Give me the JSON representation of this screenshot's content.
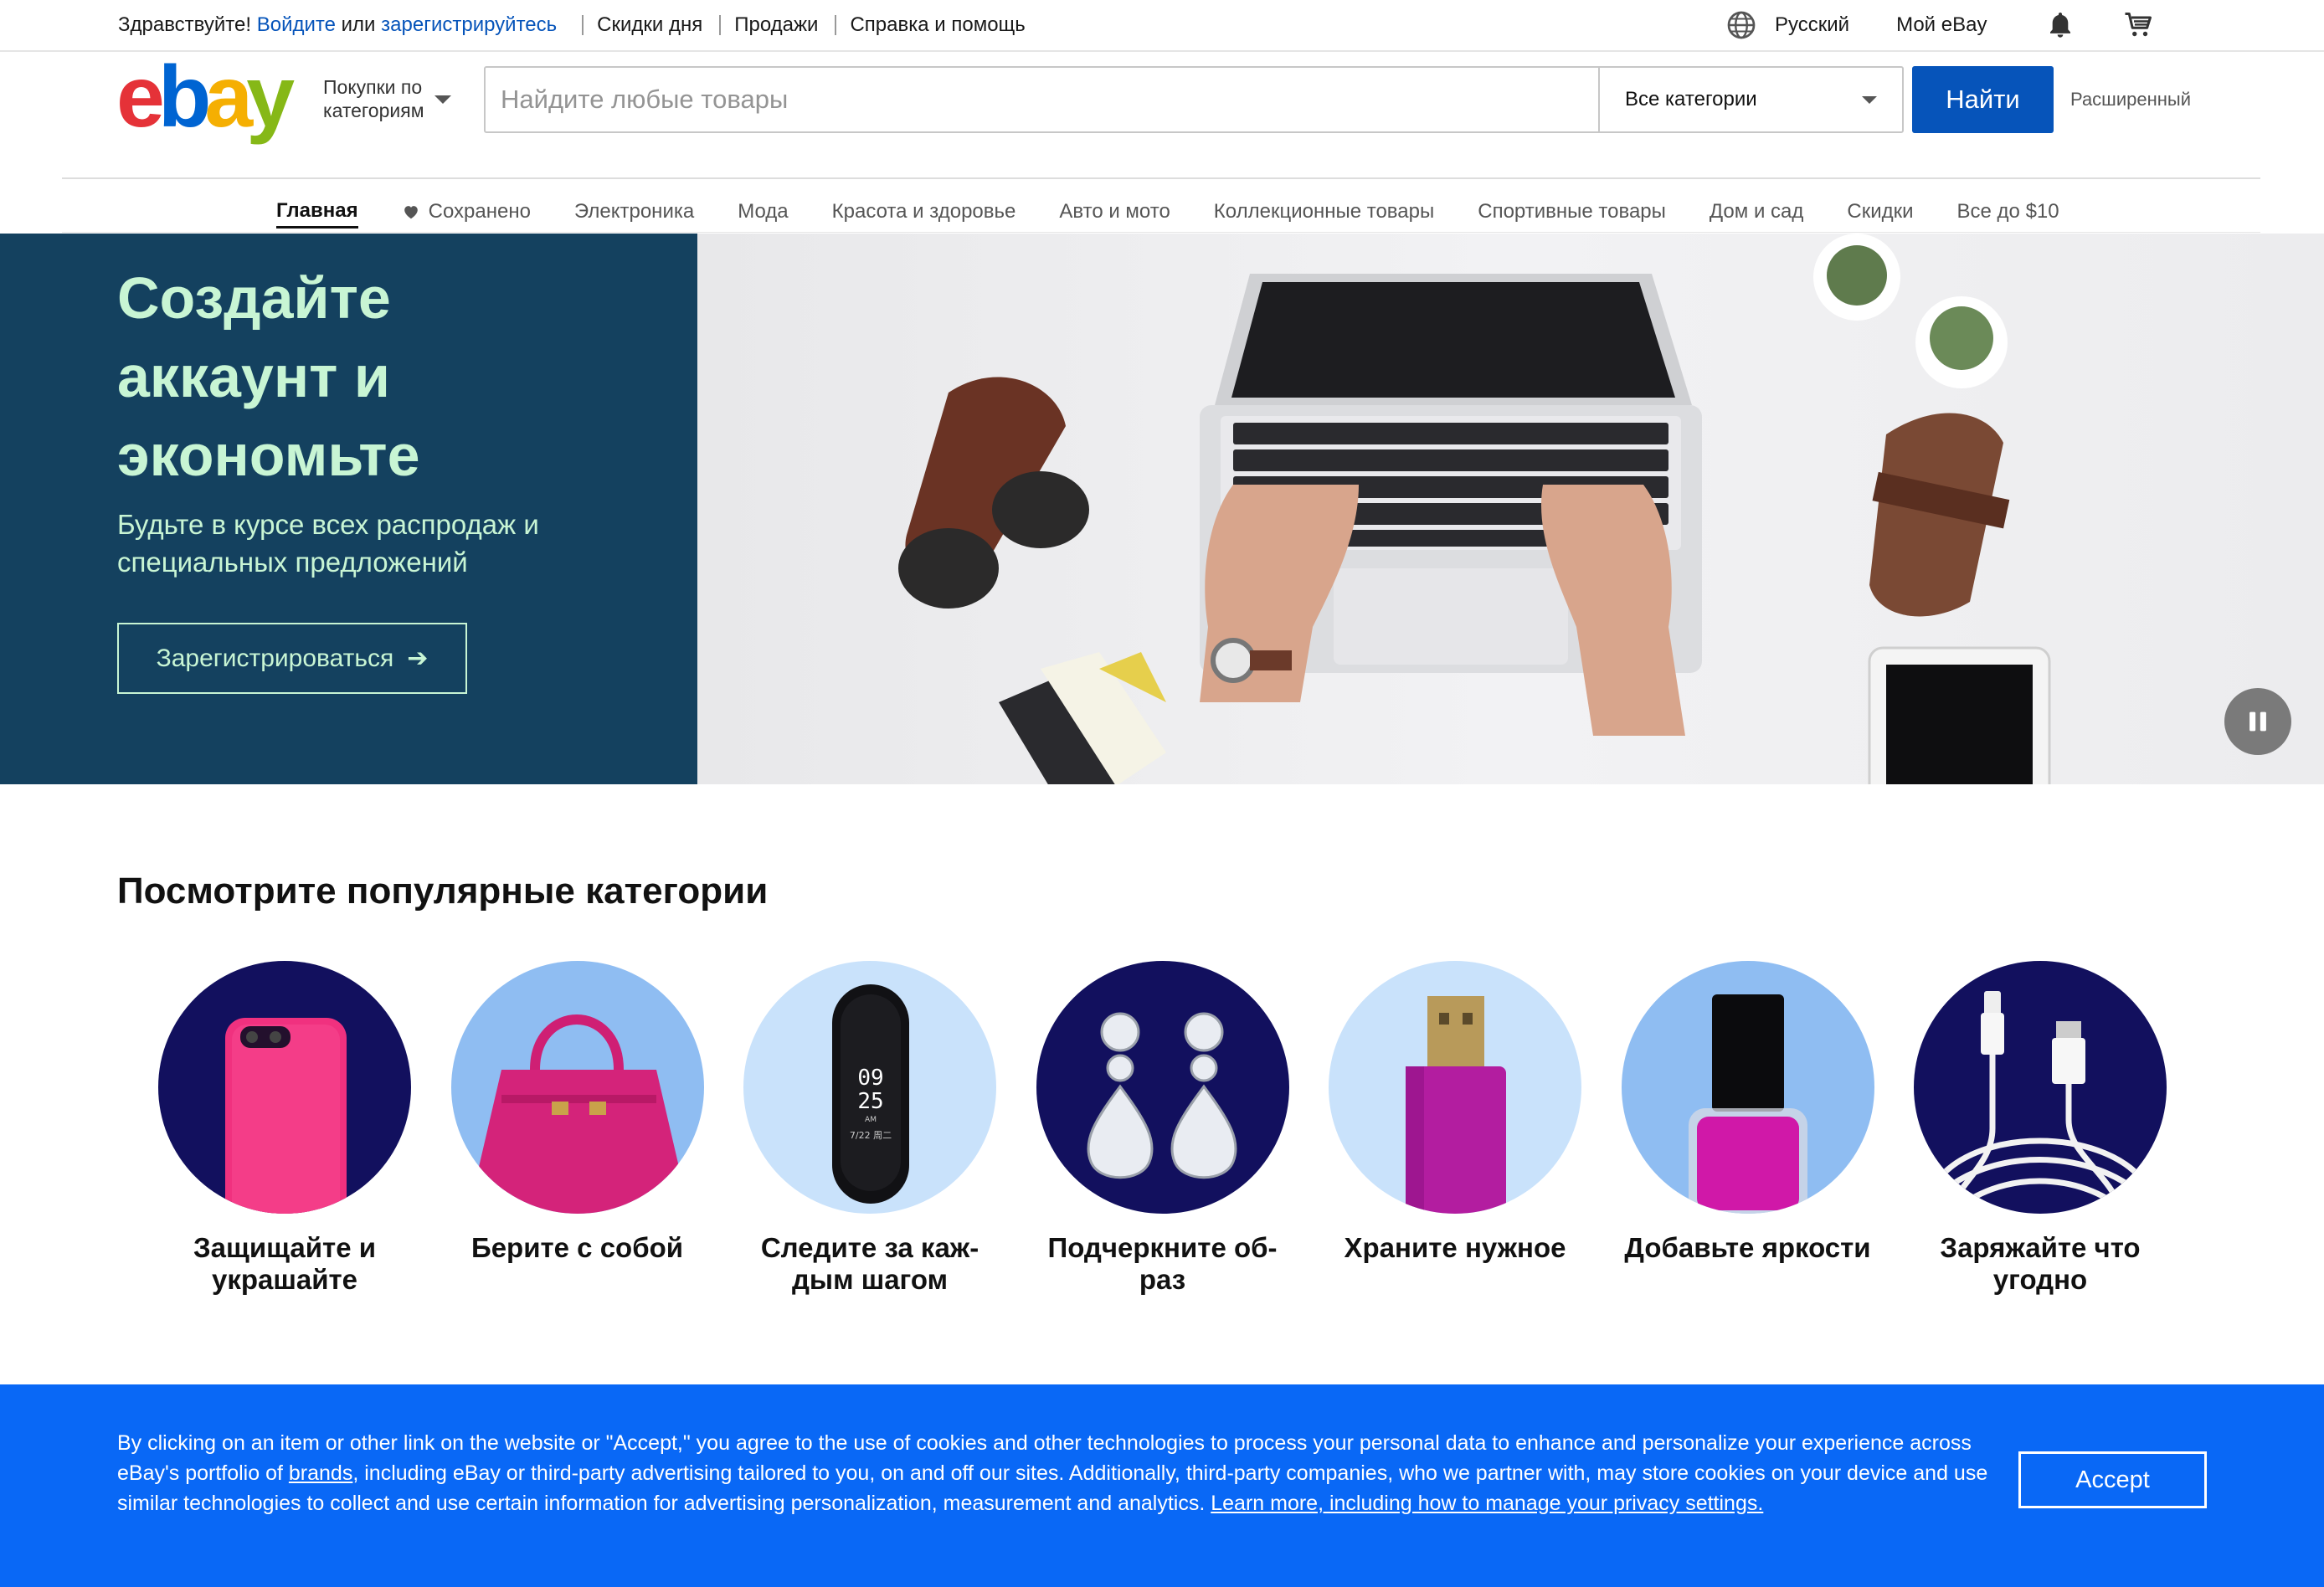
{
  "topbar": {
    "greeting": "Здравствуйте!",
    "signin": "Войдите",
    "or": "или",
    "register": "зарегистрируйтесь",
    "links": [
      "Скидки дня",
      "Продажи",
      "Справка и помощь"
    ],
    "language": "Русский",
    "my_ebay": "Мой eBay"
  },
  "header": {
    "logo": {
      "e": "e",
      "b": "b",
      "a": "a",
      "y": "y"
    },
    "shop_by_line1": "Покупки по",
    "shop_by_line2": "категориям",
    "search_placeholder": "Найдите любые товары",
    "category_select": "Все категории",
    "search_button": "Найти",
    "advanced": "Расширенный"
  },
  "nav": {
    "items": [
      "Главная",
      "Сохранено",
      "Электроника",
      "Мода",
      "Красота и здоровье",
      "Авто и мото",
      "Коллекционные товары",
      "Спортивные товары",
      "Дом и сад",
      "Скидки",
      "Все до $10"
    ]
  },
  "hero": {
    "title_line1": "Создайте",
    "title_line2": "аккаунт и",
    "title_line3": "экономьте",
    "subtitle": "Будьте в курсе всех распродаж и специальных предложений",
    "button": "Зарегистрироваться",
    "button_arrow": "➔",
    "colors": {
      "panel": "#14415f",
      "text": "#c8f5d4"
    }
  },
  "categories": {
    "title": "Посмотрите популярные категории",
    "items": [
      {
        "label": "Защищайте и украшайте",
        "icon": "phone-case-icon"
      },
      {
        "label": "Берите с собой",
        "icon": "handbag-icon"
      },
      {
        "label": "Следите за каж-дым шагом",
        "icon": "fitness-tracker-icon"
      },
      {
        "label": "Подчеркните об-раз",
        "icon": "earrings-icon"
      },
      {
        "label": "Храните нужное",
        "icon": "usb-drive-icon"
      },
      {
        "label": "Добавьте яркости",
        "icon": "nail-polish-icon"
      },
      {
        "label": "Заряжайте что угодно",
        "icon": "cable-icon"
      }
    ],
    "tracker_time_h": "09",
    "tracker_time_m": "25",
    "tracker_am": "AM",
    "tracker_date": "7/22 周二"
  },
  "cookie": {
    "text_part1": "By clicking on an item or other link on the website or \"Accept,\" you agree to the use of cookies and other technologies to process your personal data to enhance and personalize your experience across eBay's portfolio of ",
    "brands_link": "brands",
    "text_part2": ", including eBay or third-party advertising tailored to you, on and off our sites. Additionally, third-party companies, who we partner with, may store cookies on your device and use similar technologies to collect and use certain information for advertising personalization, measurement and analytics. ",
    "learn_more_link": "Learn more, including how to manage your privacy settings.",
    "accept": "Accept",
    "background": "#0968f6"
  },
  "colors": {
    "link": "#0654ba",
    "button": "#0654ba"
  }
}
